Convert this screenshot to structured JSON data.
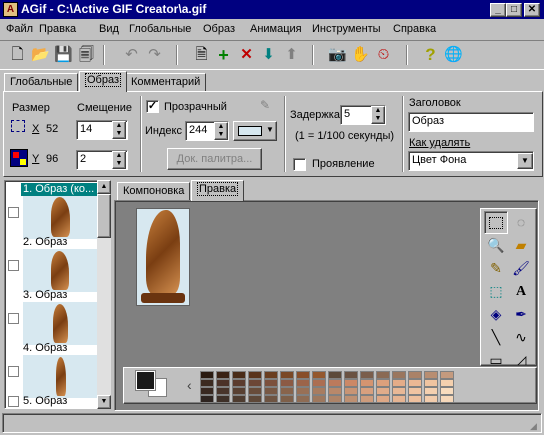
{
  "window": {
    "title": "AGif - C:\\Active GIF Creator\\a.gif",
    "min": "_",
    "max": "□",
    "close": "✕",
    "app_icon": "A"
  },
  "menu": [
    "Файл",
    "Правка",
    "Вид",
    "Глобальные",
    "Образ",
    "Анимация",
    "Инструменты",
    "Справка"
  ],
  "toolbar": {
    "new": "🗋",
    "open": "📂",
    "save": "💾",
    "saveall": "🗐",
    "undo": "↶",
    "redo": "↷",
    "add_frame": "🗎",
    "insert": "+",
    "delete": "✕",
    "move_down": "⬇",
    "move_up": "⬆",
    "camera": "📷",
    "hand": "✋",
    "clock": "⏲",
    "help": "?",
    "globe": "🌐"
  },
  "tabs": [
    "Глобальные",
    "Образ",
    "Комментарий"
  ],
  "image_panel": {
    "size_label": "Размер",
    "x_label": "X",
    "x_value": "52",
    "y_label": "Y",
    "y_value": "96",
    "offset_label": "Смещение",
    "offset_x": "14",
    "offset_y": "2",
    "transparent_label": "Прозрачный",
    "index_label": "Индекс",
    "index_value": "244",
    "transparent_color": "#d7e8f0",
    "palette_button": "Док. палитра...",
    "delay_label": "Задержка",
    "delay_value": "5",
    "delay_note": "(1 = 1/100 секунды)",
    "fadein_label": "Проявление",
    "caption_label": "Заголовок",
    "caption_value": "Образ",
    "remove_label": "Как удалять",
    "remove_value": "Цвет Фона"
  },
  "frames": [
    {
      "label": "1. Образ (ко...",
      "selected": true
    },
    {
      "label": "2. Образ",
      "selected": false
    },
    {
      "label": "3. Образ",
      "selected": false
    },
    {
      "label": "4. Образ",
      "selected": false
    },
    {
      "label": "5. Образ",
      "selected": false
    }
  ],
  "editor_tabs": [
    "Компоновка",
    "Правка"
  ],
  "tools": [
    "select-rect",
    "select-lasso",
    "zoom",
    "eraser",
    "pencil",
    "brush",
    "fill",
    "text",
    "bucket",
    "eyedropper",
    "line",
    "curve",
    "rectangle",
    "polygon"
  ],
  "tool_glyphs": {
    "text": "A"
  },
  "colors": {
    "titlebar": "#000080",
    "selection": "#008080",
    "foreground": "#1a1a1a",
    "background": "#ffffff",
    "palette": [
      "#2a1a10",
      "#3a2214",
      "#4a2c18",
      "#5a341c",
      "#6a3e20",
      "#7a4826",
      "#884e2a",
      "#94582e",
      "#5c4a3a",
      "#6a5242",
      "#7a5e4c",
      "#8a6a54",
      "#9a765e",
      "#aa8268",
      "#b88e72",
      "#c49a7e",
      "#3c2a20",
      "#4c3228",
      "#5c3c2e",
      "#6c4636",
      "#7c503c",
      "#8c5a44",
      "#9c644a",
      "#ac6e52",
      "#bc7a5c",
      "#cc8866",
      "#d49470",
      "#dca07c",
      "#e4ac88",
      "#ecb894",
      "#f0c4a0",
      "#f4d0ae",
      "#382820",
      "#48342a",
      "#584032",
      "#684c3a",
      "#785844",
      "#88644c",
      "#987056",
      "#a87c60",
      "#b8886a",
      "#c89474",
      "#d8a07e",
      "#e0ac8a",
      "#e8b896",
      "#f0c4a2",
      "#f4d0b0",
      "#f8dcbe",
      "#2e2420",
      "#3e3028",
      "#4e3c30",
      "#5e4838",
      "#6e5442",
      "#7e604a",
      "#8e6c54",
      "#9e785e",
      "#ae8468",
      "#be9072",
      "#ce9c7c",
      "#dea886",
      "#e6b492",
      "#eec09e",
      "#f2ccac",
      "#f6d8ba"
    ]
  },
  "palette_arrows": {
    "left": "‹",
    "right": "›"
  }
}
